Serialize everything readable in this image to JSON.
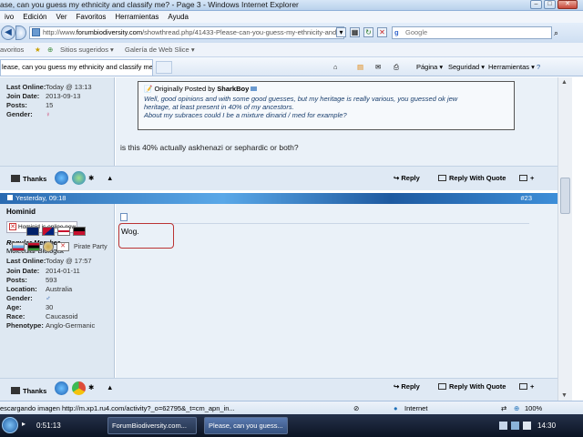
{
  "window": {
    "title": "ase, can you guess my ethnicity and classify me? - Page 3 - Windows Internet Explorer"
  },
  "menu": [
    "ivo",
    "Edición",
    "Ver",
    "Favoritos",
    "Herramientas",
    "Ayuda"
  ],
  "address": {
    "prefix": "http://www.",
    "domain": "forumbiodiversity.com",
    "path": "/showthread.php/41433-Please-can-you-guess-my-ethnicity-and-classif"
  },
  "search": {
    "engine_glyph": "g",
    "placeholder": "Google"
  },
  "favorites": {
    "label": "avoritos",
    "items": [
      "Sitios sugeridos ▾",
      "Galería de Web Slice ▾"
    ]
  },
  "tab": {
    "title": "lease, can you guess my ethnicity and classify me? - ..."
  },
  "commands": {
    "page": "Página ▾",
    "security": "Seguridad ▾",
    "tools": "Herramientas ▾"
  },
  "post1": {
    "user_fields": [
      {
        "k": "Last Online:",
        "v": "Today @ 13:13"
      },
      {
        "k": "Join Date:",
        "v": "2013-09-13"
      },
      {
        "k": "Posts:",
        "v": "15"
      },
      {
        "k": "Gender:",
        "v": "♀"
      }
    ],
    "quote_header_prefix": "Originally Posted by",
    "quote_author": "SharkBoy",
    "quote_lines": [
      "Well, good opinions and with some good guesses, but my heritage is really various, you guessed ok jew",
      "heritage, at least present in 40% of my ancestors.",
      "About my subraces could I be a mixture dinarid / med for example?"
    ],
    "body": "is this 40% actually askhenazi or sephardic or both?",
    "thanks": "Thanks",
    "reply": "Reply",
    "reply_quote": "Reply With Quote"
  },
  "post2": {
    "date": "Yesterday, 09:18",
    "number": "#23",
    "username": "Hominid",
    "online": "Hominid is online now",
    "rank": "Regular Member",
    "subtitle": "Molecular Biologist",
    "user_fields": [
      {
        "k": "Last Online:",
        "v": "Today @ 17:57"
      },
      {
        "k": "Join Date:",
        "v": "2014-01-11"
      },
      {
        "k": "Posts:",
        "v": "593"
      },
      {
        "k": "Location:",
        "v": "Australia"
      },
      {
        "k": "Gender:",
        "v": "♂"
      },
      {
        "k": "Age:",
        "v": "30"
      },
      {
        "k": "Race:",
        "v": "Caucasoid"
      },
      {
        "k": "Phenotype:",
        "v": "Anglo-Germanic"
      }
    ],
    "party": "Pirate Party",
    "body": "Wog.",
    "thanks": "Thanks",
    "reply": "Reply",
    "reply_quote": "Reply With Quote"
  },
  "status": {
    "text": "escargando imagen http://m.xp1.ru4.com/activity?_o=62795&_t=cm_apn_in...",
    "zone": "Internet",
    "zoom": "100%"
  },
  "taskbar": {
    "timer": "0:51:13",
    "tasks": [
      "ForumBiodiversity.com...",
      "Please, can you guess..."
    ],
    "clock": "14:30"
  }
}
